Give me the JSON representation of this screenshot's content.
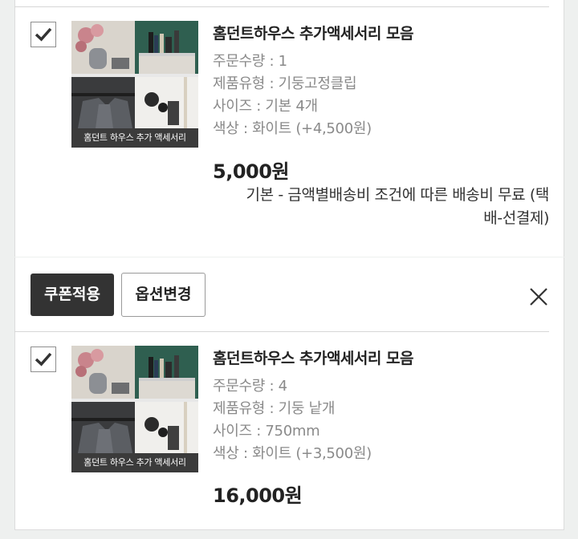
{
  "items": [
    {
      "checked": true,
      "thumb_caption": "홈던트 하우스 추가 액세서리",
      "name": "홈던트하우스 추가액세서리 모음",
      "options": [
        "주문수량 : 1",
        "제품유형 : 기둥고정클립",
        "사이즈 : 기본 4개",
        "색상 : 화이트 (+4,500원)"
      ],
      "price": "5,000원",
      "shipping_line1": "기본 - 금액별배송비 조건에 따른 배송비 무료 (택",
      "shipping_line2": "배-선결제)"
    },
    {
      "checked": true,
      "thumb_caption": "홈던트 하우스 추가 액세서리",
      "name": "홈던트하우스 추가액세서리 모음",
      "options": [
        "주문수량 : 4",
        "제품유형 : 기둥 낱개",
        "사이즈 : 750mm",
        "색상 : 화이트 (+3,500원)"
      ],
      "price": "16,000원"
    }
  ],
  "actions": {
    "coupon_label": "쿠폰적용",
    "option_label": "옵션변경"
  },
  "icons": {
    "check": "check-icon",
    "close": "close-icon"
  },
  "colors": {
    "background": "#eef0ef",
    "dark_button": "#333333",
    "option_text": "#8a8a8a"
  }
}
